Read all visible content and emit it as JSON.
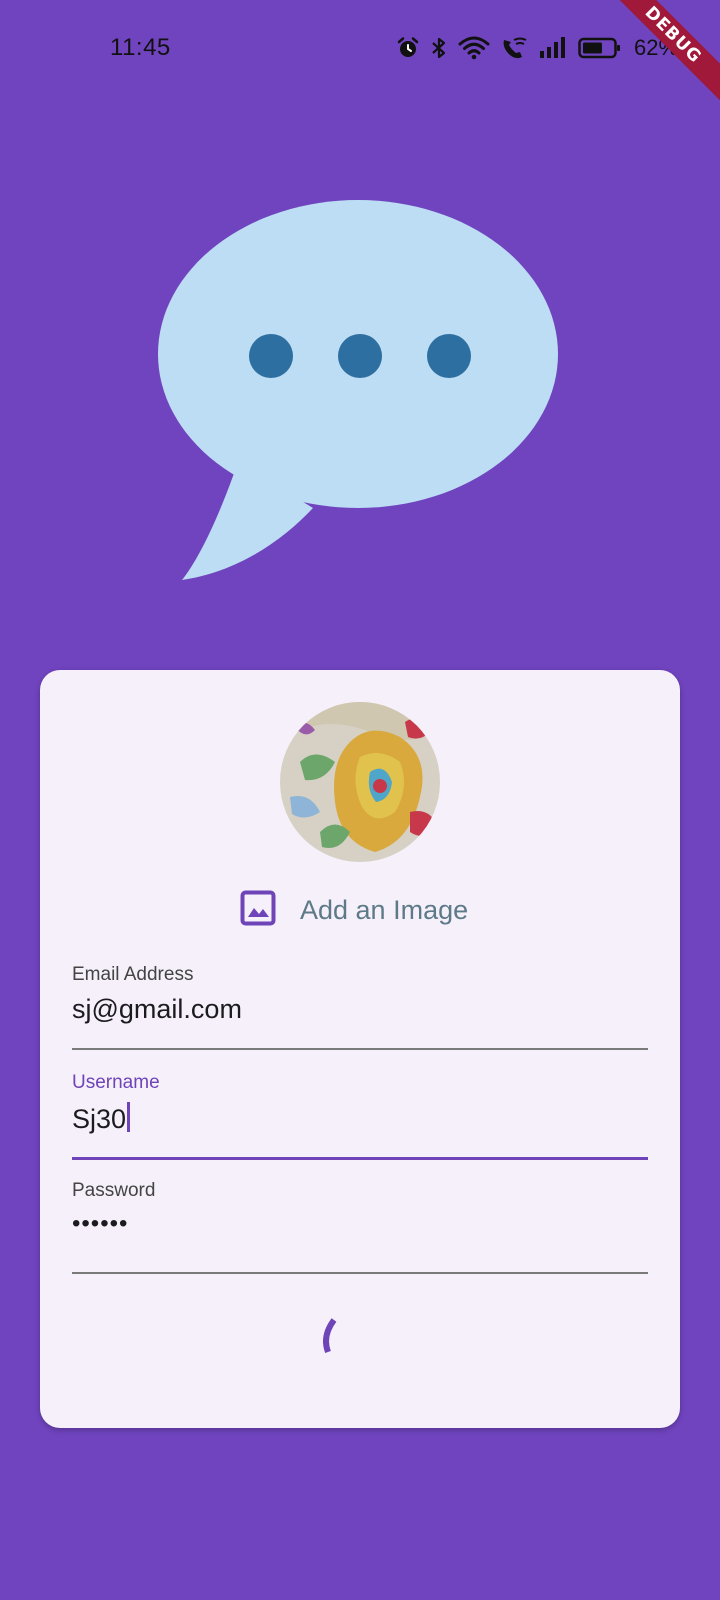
{
  "status_bar": {
    "time": "11:45",
    "battery_percent": "62%",
    "icons": [
      "alarm-icon",
      "bluetooth-icon",
      "wifi-icon",
      "wifi-calling-icon",
      "signal-icon",
      "battery-icon"
    ]
  },
  "debug_banner": "DEBUG",
  "form": {
    "add_image_label": "Add an Image",
    "email": {
      "label": "Email Address",
      "value": "sj@gmail.com"
    },
    "username": {
      "label": "Username",
      "value": "Sj30"
    },
    "password": {
      "label": "Password",
      "value": "••••••"
    }
  },
  "colors": {
    "background": "#7044BF",
    "card": "#F6F0FA",
    "accent": "#6E44B8",
    "bubble": "#BCDDF4",
    "bubble_dots": "#2E6FA1"
  }
}
